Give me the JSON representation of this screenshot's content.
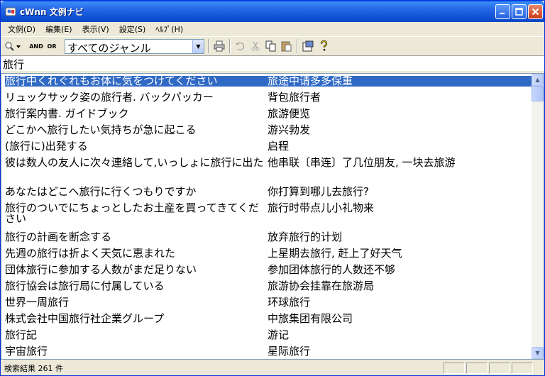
{
  "window": {
    "title": "cWnn 文例ナビ"
  },
  "menu": [
    "文例(D)",
    "編集(E)",
    "表示(V)",
    "設定(S)",
    "ﾍﾙﾌﾟ(H)"
  ],
  "toolbar": {
    "and_label": "AND",
    "or_label": "OR",
    "genre_value": "すべてのジャンル"
  },
  "search": {
    "query": "旅行"
  },
  "results": [
    {
      "ja": "旅行中くれぐれもお体に気をつけてください",
      "zh": "旅途中请多多保重",
      "selected": true
    },
    {
      "ja": "リュックサック姿の旅行者. バックパッカー",
      "zh": "背包旅行者"
    },
    {
      "ja": "旅行案内書. ガイドブック",
      "zh": "旅游便览"
    },
    {
      "ja": "どこかへ旅行したい気持ちが急に起こる",
      "zh": "游兴勃发"
    },
    {
      "ja": "(旅行に)出発する",
      "zh": "启程"
    },
    {
      "ja": "彼は数人の友人に次々連絡して,いっしょに旅行に出た",
      "zh": "他串联〔串连〕了几位朋友, 一块去旅游"
    },
    {
      "ja": "あなたはどこへ旅行に行くつもりですか",
      "zh": "你打算到哪儿去旅行?"
    },
    {
      "ja": "旅行のついでにちょっとしたお土産を買ってきてください",
      "zh": "旅行时带点儿小礼物来"
    },
    {
      "ja": "旅行の計画を断念する",
      "zh": "放弃旅行的计划"
    },
    {
      "ja": "先週の旅行は折よく天気に恵まれた",
      "zh": "上星期去旅行, 赶上了好天气"
    },
    {
      "ja": "団体旅行に参加する人数がまだ足りない",
      "zh": "参加团体旅行的人数还不够"
    },
    {
      "ja": "旅行協会は旅行局に付属している",
      "zh": "旅游协会挂靠在旅游局"
    },
    {
      "ja": "世界一周旅行",
      "zh": "环球旅行"
    },
    {
      "ja": "株式会社中国旅行社企業グループ",
      "zh": "中旅集团有限公司"
    },
    {
      "ja": "旅行記",
      "zh": "游记"
    },
    {
      "ja": "宇宙旅行",
      "zh": "星际旅行"
    }
  ],
  "status": {
    "text": "検索結果 261 件"
  }
}
